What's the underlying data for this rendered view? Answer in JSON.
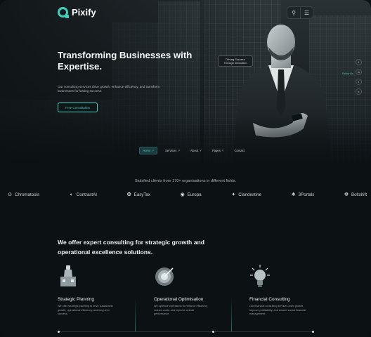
{
  "brand": {
    "name": "Pixify"
  },
  "header": {
    "search_icon": "search-icon",
    "menu_icon": "menu-icon"
  },
  "hero": {
    "title": "Transforming Businesses with Expertise.",
    "description": "Our consulting services drive growth, enhance efficiency, and transform businesses for lasting success.",
    "cta_label": "Free Consultation",
    "badge_text": "Driving Success Through Innovation"
  },
  "social": {
    "follow_label": "Follow Us",
    "items": [
      "f",
      "in",
      "t",
      "x"
    ]
  },
  "nav": {
    "items": [
      {
        "label": "Home",
        "active": true,
        "has_dropdown": true
      },
      {
        "label": "Services",
        "active": false,
        "has_dropdown": true
      },
      {
        "label": "About",
        "active": false,
        "has_dropdown": true
      },
      {
        "label": "Pages",
        "active": false,
        "has_dropdown": true
      },
      {
        "label": "Contact",
        "active": false,
        "has_dropdown": false
      }
    ]
  },
  "clients": {
    "caption": "Satisfied clients from 170+ organisations in different fields.",
    "items": [
      {
        "name": "Chromatools",
        "icon": "chromatools-icon",
        "glyph": "⊙"
      },
      {
        "name": "ContrastAI",
        "icon": "contrastai-icon",
        "glyph": "◐"
      },
      {
        "name": "EasyTax",
        "icon": "easytax-icon",
        "glyph": "❂"
      },
      {
        "name": "Europa",
        "icon": "europa-icon",
        "glyph": "◉"
      },
      {
        "name": "Clandestine",
        "icon": "clandestine-icon",
        "glyph": "✦"
      },
      {
        "name": "3Portals",
        "icon": "3portals-icon",
        "glyph": "❖"
      },
      {
        "name": "Boltshift",
        "icon": "boltshift-icon",
        "glyph": "❆"
      }
    ]
  },
  "offer": {
    "title": "We offer expert consulting for strategic growth and operational excellence solutions.",
    "cards": [
      {
        "title": "Strategic Planning",
        "icon": "chess-piece-icon",
        "description": "We offer strategic planning to drive sustainable growth, operational efficiency, and long-term success."
      },
      {
        "title": "Operational Optimisation",
        "icon": "target-icon",
        "description": "We optimize operations to enhance efficiency, reduce costs, and improve overall performance."
      },
      {
        "title": "Financial Consulting",
        "icon": "lightbulb-icon",
        "description": "Our financial consulting services drive growth, improve profitability, and ensure sound financial management."
      }
    ]
  },
  "colors": {
    "accent": "#3fd1c0",
    "background": "#0c1113"
  }
}
